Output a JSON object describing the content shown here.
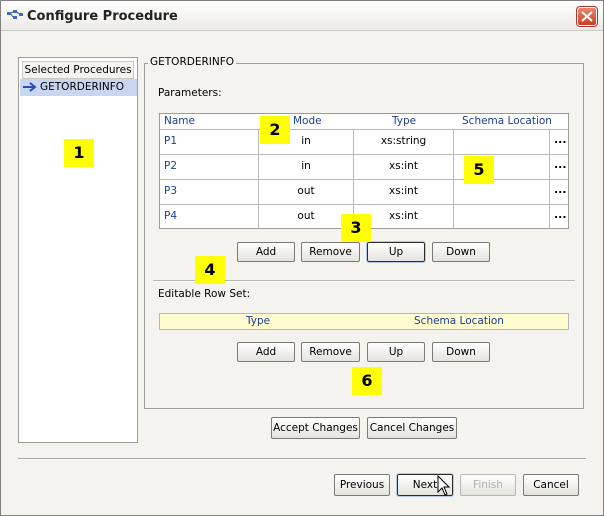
{
  "window": {
    "title": "Configure Procedure"
  },
  "procedures": {
    "header": "Selected Procedures",
    "items": [
      "GETORDERINFO"
    ]
  },
  "group": {
    "title": "GETORDERINFO"
  },
  "parameters": {
    "label": "Parameters:",
    "columns": [
      "Name",
      "Mode",
      "Type",
      "Schema Location"
    ],
    "rows": [
      {
        "name": "P1",
        "mode": "in",
        "type": "xs:string",
        "schema": ""
      },
      {
        "name": "P2",
        "mode": "in",
        "type": "xs:int",
        "schema": ""
      },
      {
        "name": "P3",
        "mode": "out",
        "type": "xs:int",
        "schema": ""
      },
      {
        "name": "P4",
        "mode": "out",
        "type": "xs:int",
        "schema": ""
      }
    ],
    "browse_label": "..."
  },
  "param_buttons": {
    "add": "Add",
    "remove": "Remove",
    "up": "Up",
    "down": "Down"
  },
  "rowset": {
    "label": "Editable Row Set:",
    "columns": [
      "Type",
      "Schema Location"
    ]
  },
  "rowset_buttons": {
    "add": "Add",
    "remove": "Remove",
    "up": "Up",
    "down": "Down"
  },
  "actions": {
    "accept": "Accept Changes",
    "cancel_changes": "Cancel Changes"
  },
  "nav": {
    "previous": "Previous",
    "next": "Next",
    "finish": "Finish",
    "cancel": "Cancel"
  },
  "callouts": [
    "1",
    "2",
    "3",
    "4",
    "5",
    "6"
  ],
  "colors": {
    "highlight": "#ffff00",
    "header_text": "#1c3e8c",
    "selection": "#c8d6f0",
    "rowset_bg": "#fffcd0"
  }
}
